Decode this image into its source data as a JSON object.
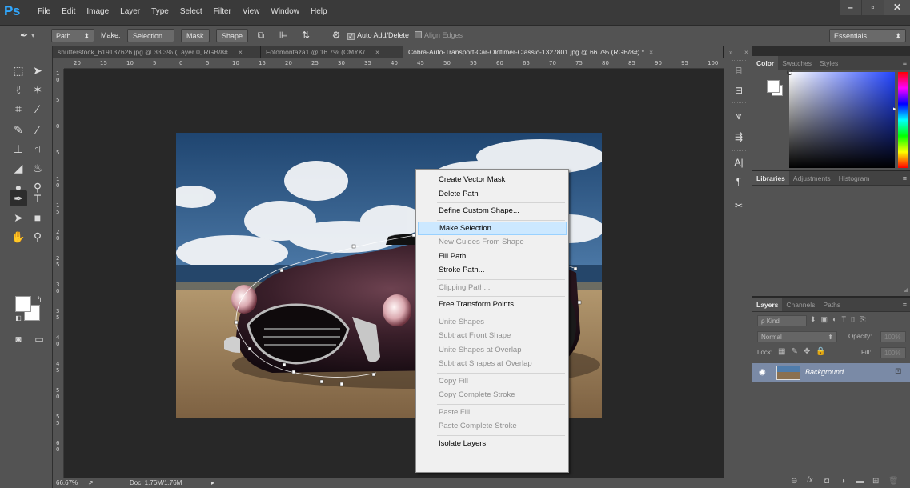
{
  "app": {
    "logo": "Ps",
    "menu": [
      "File",
      "Edit",
      "Image",
      "Layer",
      "Type",
      "Select",
      "Filter",
      "View",
      "Window",
      "Help"
    ],
    "window_buttons": [
      "–",
      "▫",
      "✕"
    ]
  },
  "options_bar": {
    "mode": "Path",
    "make_label": "Make:",
    "selection_btn": "Selection...",
    "mask_btn": "Mask",
    "shape_btn": "Shape",
    "auto_add_delete": "Auto Add/Delete",
    "align_edges": "Align Edges",
    "workspace": "Essentials"
  },
  "tabs": [
    "shutterstock_619137626.jpg @ 33.3% (Layer 0, RGB/8#...",
    "Fotomontaza1 @ 16.7% (CMYK/...",
    "Cobra-Auto-Transport-Car-Oldtimer-Classic-1327801.jpg @ 66.7% (RGB/8#) *"
  ],
  "hruler_ticks": [
    "20",
    "15",
    "10",
    "5",
    "0",
    "5",
    "10",
    "15",
    "20",
    "25",
    "30",
    "35",
    "40",
    "45",
    "50",
    "55",
    "60",
    "65",
    "70",
    "75",
    "80",
    "85",
    "90",
    "95",
    "100"
  ],
  "vruler_ticks": [
    "1\n0",
    "5",
    "0",
    "5",
    "1\n0",
    "1\n5",
    "2\n0",
    "2\n5",
    "3\n0",
    "3\n5",
    "4\n0",
    "4\n5",
    "5\n0",
    "5\n5",
    "6\n0"
  ],
  "status": {
    "zoom": "66.67%",
    "doc": "Doc: 1.76M/1.76M"
  },
  "context_menu": {
    "items": [
      {
        "label": "Create Vector Mask",
        "state": "normal"
      },
      {
        "label": "Delete Path",
        "state": "normal"
      },
      {
        "sep": true
      },
      {
        "label": "Define Custom Shape...",
        "state": "normal"
      },
      {
        "sep": true
      },
      {
        "label": "Make Selection...",
        "state": "highlight"
      },
      {
        "label": "New Guides From Shape",
        "state": "disabled"
      },
      {
        "label": "Fill Path...",
        "state": "normal"
      },
      {
        "label": "Stroke Path...",
        "state": "normal"
      },
      {
        "sep": true
      },
      {
        "label": "Clipping Path...",
        "state": "disabled"
      },
      {
        "sep": true
      },
      {
        "label": "Free Transform Points",
        "state": "normal"
      },
      {
        "sep": true
      },
      {
        "label": "Unite Shapes",
        "state": "disabled"
      },
      {
        "label": "Subtract Front Shape",
        "state": "disabled"
      },
      {
        "label": "Unite Shapes at Overlap",
        "state": "disabled"
      },
      {
        "label": "Subtract Shapes at Overlap",
        "state": "disabled"
      },
      {
        "sep": true
      },
      {
        "label": "Copy Fill",
        "state": "disabled"
      },
      {
        "label": "Copy Complete Stroke",
        "state": "disabled"
      },
      {
        "sep": true
      },
      {
        "label": "Paste Fill",
        "state": "disabled"
      },
      {
        "label": "Paste Complete Stroke",
        "state": "disabled"
      },
      {
        "sep": true
      },
      {
        "label": "Isolate Layers",
        "state": "normal"
      }
    ]
  },
  "color_panel": {
    "tabs": [
      "Color",
      "Swatches",
      "Styles"
    ],
    "active": "Color"
  },
  "libraries_panel": {
    "tabs": [
      "Libraries",
      "Adjustments",
      "Histogram"
    ],
    "active": "Libraries"
  },
  "layers_panel": {
    "tabs": [
      "Layers",
      "Channels",
      "Paths"
    ],
    "active": "Layers",
    "filter": "ρ Kind",
    "blend_mode": "Normal",
    "opacity_label": "Opacity:",
    "opacity_value": "100%",
    "lock_label": "Lock:",
    "fill_label": "Fill:",
    "fill_value": "100%",
    "layer_name": "Background"
  },
  "colors": {
    "menu_bg": "#3a3a3a",
    "panel_bg": "#535353",
    "canvas_bg": "#282828",
    "ps_blue": "#31a8ff",
    "highlight": "#cce8ff"
  }
}
